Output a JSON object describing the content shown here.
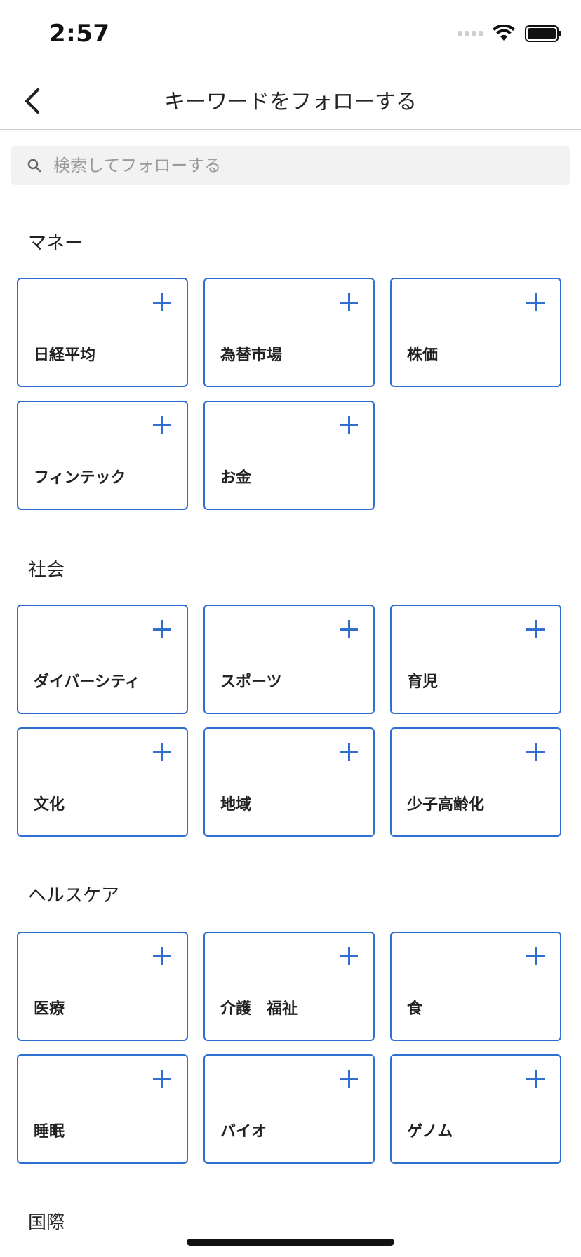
{
  "status_bar": {
    "time": "2:57"
  },
  "nav": {
    "title": "キーワードをフォローする"
  },
  "search": {
    "placeholder": "検索してフォローする",
    "value": ""
  },
  "sections": [
    {
      "title": "マネー",
      "items": [
        "日経平均",
        "為替市場",
        "株価",
        "フィンテック",
        "お金"
      ]
    },
    {
      "title": "社会",
      "items": [
        "ダイバーシティ",
        "スポーツ",
        "育児",
        "文化",
        "地域",
        "少子高齢化"
      ]
    },
    {
      "title": "ヘルスケア",
      "items": [
        "医療",
        "介護　福祉",
        "食",
        "睡眠",
        "バイオ",
        "ゲノム"
      ]
    },
    {
      "title": "国際",
      "items": []
    }
  ],
  "colors": {
    "accent": "#2f6fd1",
    "text": "#222222",
    "search_bg": "#f2f2f2"
  },
  "icons": {
    "back": "chevron-left-icon",
    "search": "search-icon",
    "add": "plus-icon"
  }
}
